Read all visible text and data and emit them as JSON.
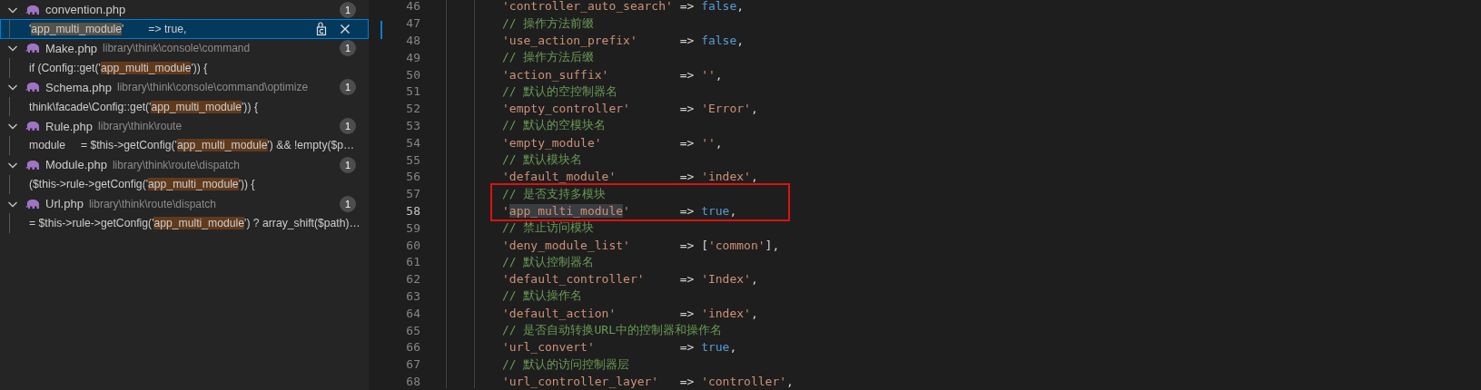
{
  "search_results": [
    {
      "file": "convention.php",
      "count": "1",
      "expanded": true,
      "matches": [
        {
          "before": "'",
          "match": "app_multi_module",
          "after": "'        => true,",
          "selected": true
        }
      ]
    },
    {
      "file": "Make.php",
      "path": "library\\think\\console\\command",
      "count": "1",
      "expanded": true,
      "matches": [
        {
          "before": "if (Config::get('",
          "match": "app_multi_module",
          "after": "')) {",
          "selected": false
        }
      ]
    },
    {
      "file": "Schema.php",
      "path": "library\\think\\console\\command\\optimize",
      "count": "1",
      "expanded": true,
      "matches": [
        {
          "before": "think\\facade\\Config::get('",
          "match": "app_multi_module",
          "after": "')) {",
          "selected": false
        }
      ]
    },
    {
      "file": "Rule.php",
      "path": "library\\think\\route",
      "count": "1",
      "expanded": true,
      "matches": [
        {
          "before": "module     = $this->getConfig('",
          "match": "app_multi_module",
          "after": "') && !empty($p…",
          "selected": false
        }
      ]
    },
    {
      "file": "Module.php",
      "path": "library\\think\\route\\dispatch",
      "count": "1",
      "expanded": true,
      "matches": [
        {
          "before": "($this->rule->getConfig('",
          "match": "app_multi_module",
          "after": "')) {",
          "selected": false
        }
      ]
    },
    {
      "file": "Url.php",
      "path": "library\\think\\route\\dispatch",
      "count": "1",
      "expanded": true,
      "matches": [
        {
          "before": "= $this->rule->getConfig('",
          "match": "app_multi_module",
          "after": "') ? array_shift($path)…",
          "selected": false
        }
      ]
    }
  ],
  "editor": {
    "lines": [
      {
        "number": "46",
        "key": [
          {
            "kind": "string",
            "text": "'controller_auto_search'"
          }
        ],
        "value": [
          {
            "kind": "keyword",
            "text": "false"
          },
          {
            "kind": "punct",
            "text": ","
          }
        ]
      },
      {
        "number": "47",
        "comment": "// 操作方法前缀"
      },
      {
        "number": "48",
        "key": [
          {
            "kind": "string",
            "text": "'use_action_prefix'"
          }
        ],
        "value": [
          {
            "kind": "keyword",
            "text": "false"
          },
          {
            "kind": "punct",
            "text": ","
          }
        ]
      },
      {
        "number": "49",
        "comment": "// 操作方法后缀"
      },
      {
        "number": "50",
        "key": [
          {
            "kind": "string",
            "text": "'action_suffix'"
          }
        ],
        "value": [
          {
            "kind": "string",
            "text": "''"
          },
          {
            "kind": "punct",
            "text": ","
          }
        ]
      },
      {
        "number": "51",
        "comment": "// 默认的空控制器名"
      },
      {
        "number": "52",
        "key": [
          {
            "kind": "string",
            "text": "'empty_controller'"
          }
        ],
        "value": [
          {
            "kind": "string",
            "text": "'Error'"
          },
          {
            "kind": "punct",
            "text": ","
          }
        ]
      },
      {
        "number": "53",
        "comment": "// 默认的空模块名"
      },
      {
        "number": "54",
        "key": [
          {
            "kind": "string",
            "text": "'empty_module'"
          }
        ],
        "value": [
          {
            "kind": "string",
            "text": "''"
          },
          {
            "kind": "punct",
            "text": ","
          }
        ]
      },
      {
        "number": "55",
        "comment": "// 默认模块名"
      },
      {
        "number": "56",
        "key": [
          {
            "kind": "string",
            "text": "'default_module'"
          }
        ],
        "value": [
          {
            "kind": "string",
            "text": "'index'"
          },
          {
            "kind": "punct",
            "text": ","
          }
        ]
      },
      {
        "number": "57",
        "comment": "// 是否支持多模块",
        "boxed": true,
        "current": false
      },
      {
        "number": "58",
        "key": [
          {
            "kind": "string",
            "text": "'"
          },
          {
            "kind": "string",
            "text": "app_multi_module",
            "highlighted": true
          },
          {
            "kind": "string",
            "text": "'"
          }
        ],
        "value": [
          {
            "kind": "keyword",
            "text": "true"
          },
          {
            "kind": "punct",
            "text": ","
          }
        ],
        "boxed": true,
        "current": true
      },
      {
        "number": "59",
        "comment": "// 禁止访问模块"
      },
      {
        "number": "60",
        "key": [
          {
            "kind": "string",
            "text": "'deny_module_list'"
          }
        ],
        "value": [
          {
            "kind": "punct",
            "text": "["
          },
          {
            "kind": "string",
            "text": "'common'"
          },
          {
            "kind": "punct",
            "text": "],"
          }
        ]
      },
      {
        "number": "61",
        "comment": "// 默认控制器名"
      },
      {
        "number": "62",
        "key": [
          {
            "kind": "string",
            "text": "'default_controller'"
          }
        ],
        "value": [
          {
            "kind": "string",
            "text": "'Index'"
          },
          {
            "kind": "punct",
            "text": ","
          }
        ]
      },
      {
        "number": "63",
        "comment": "// 默认操作名"
      },
      {
        "number": "64",
        "key": [
          {
            "kind": "string",
            "text": "'default_action'"
          }
        ],
        "value": [
          {
            "kind": "string",
            "text": "'index'"
          },
          {
            "kind": "punct",
            "text": ","
          }
        ]
      },
      {
        "number": "65",
        "comment": "// 是否自动转换URL中的控制器和操作名"
      },
      {
        "number": "66",
        "key": [
          {
            "kind": "string",
            "text": "'url_convert'"
          }
        ],
        "value": [
          {
            "kind": "keyword",
            "text": "true"
          },
          {
            "kind": "punct",
            "text": ","
          }
        ]
      },
      {
        "number": "67",
        "comment": "// 默认的访问控制器层"
      },
      {
        "number": "68",
        "key": [
          {
            "kind": "string",
            "text": "'url_controller_layer'"
          }
        ],
        "value": [
          {
            "kind": "string",
            "text": "'controller'"
          },
          {
            "kind": "punct",
            "text": ","
          }
        ]
      }
    ],
    "arrow": "=>"
  }
}
